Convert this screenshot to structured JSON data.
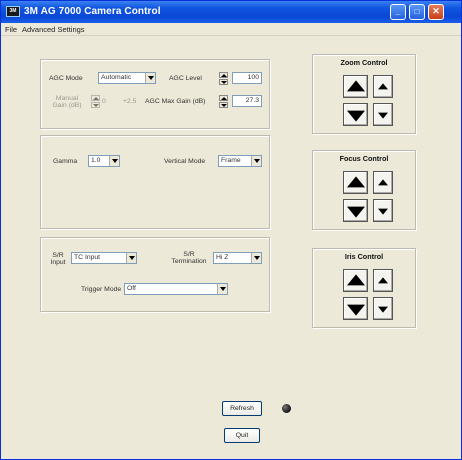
{
  "window": {
    "title": "3M AG 7000 Camera Control",
    "icon_text": "3M"
  },
  "titlebar_buttons": {
    "minimize": "_",
    "maximize": "□",
    "close": "✕"
  },
  "menu": [
    {
      "label": "File"
    },
    {
      "label": "Advanced Settings"
    }
  ],
  "agc": {
    "mode_label": "AGC Mode",
    "mode_value": "Automatic",
    "level_label": "AGC Level",
    "level_value": "100",
    "manual_gain_label": "Manual Gain (dB)",
    "manual_gain_value": "0",
    "manual_gain_right": "+2.5",
    "max_gain_label": "AGC Max Gain (dB)",
    "max_gain_value": "27.3"
  },
  "video": {
    "gamma_label": "Gamma",
    "gamma_value": "1.0",
    "vertical_mode_label": "Vertical Mode",
    "vertical_mode_value": "Frame"
  },
  "sdi": {
    "input_label": "S/R Input",
    "input_value": "TC Input",
    "termination_label": "S/R Termination",
    "termination_value": "Hi Z",
    "trigger_label": "Trigger Mode",
    "trigger_value": "Off"
  },
  "controls": [
    {
      "title": "Zoom Control"
    },
    {
      "title": "Focus Control"
    },
    {
      "title": "Iris Control"
    }
  ],
  "buttons": {
    "refresh": "Refresh",
    "quit": "Quit"
  }
}
